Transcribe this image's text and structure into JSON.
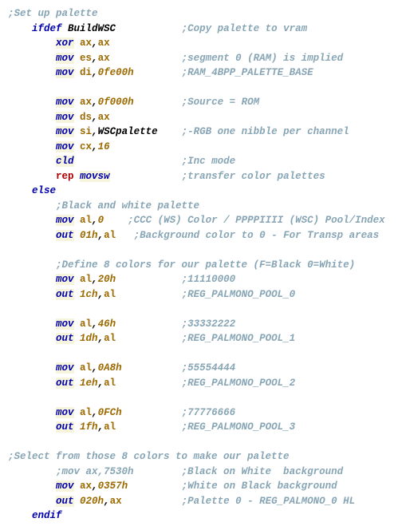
{
  "lines": [
    [
      [
        "comment",
        ";Set up palette"
      ]
    ],
    [
      [
        "plain",
        "    "
      ],
      [
        "pp",
        "ifdef"
      ],
      [
        "plain",
        " "
      ],
      [
        "ident",
        "BuildWSC"
      ],
      [
        "plain",
        "           "
      ],
      [
        "comment",
        ";Copy palette to vram"
      ]
    ],
    [
      [
        "plain",
        "        "
      ],
      [
        "inst-bg",
        "xor"
      ],
      [
        "plain",
        " "
      ],
      [
        "reg",
        "ax"
      ],
      [
        "sym",
        ","
      ],
      [
        "reg",
        "ax"
      ]
    ],
    [
      [
        "plain",
        "        "
      ],
      [
        "inst-bg",
        "mov"
      ],
      [
        "plain",
        " "
      ],
      [
        "reg",
        "es"
      ],
      [
        "sym",
        ","
      ],
      [
        "reg",
        "ax"
      ],
      [
        "plain",
        "            "
      ],
      [
        "comment",
        ";segment 0 (RAM) is implied"
      ]
    ],
    [
      [
        "plain",
        "        "
      ],
      [
        "inst-bg",
        "mov"
      ],
      [
        "plain",
        " "
      ],
      [
        "reg",
        "di"
      ],
      [
        "sym",
        ","
      ],
      [
        "num",
        "0fe00h"
      ],
      [
        "plain",
        "        "
      ],
      [
        "comment",
        ";RAM_4BPP_PALETTE_BASE"
      ]
    ],
    [
      [
        "plain",
        " "
      ]
    ],
    [
      [
        "plain",
        "        "
      ],
      [
        "inst-bg",
        "mov"
      ],
      [
        "plain",
        " "
      ],
      [
        "reg",
        "ax"
      ],
      [
        "sym",
        ","
      ],
      [
        "num",
        "0f000h"
      ],
      [
        "plain",
        "        "
      ],
      [
        "comment",
        ";Source = ROM"
      ]
    ],
    [
      [
        "plain",
        "        "
      ],
      [
        "inst-bg",
        "mov"
      ],
      [
        "plain",
        " "
      ],
      [
        "reg",
        "ds"
      ],
      [
        "sym",
        ","
      ],
      [
        "reg",
        "ax"
      ]
    ],
    [
      [
        "plain",
        "        "
      ],
      [
        "inst-bg",
        "mov"
      ],
      [
        "plain",
        " "
      ],
      [
        "reg",
        "si"
      ],
      [
        "sym",
        ","
      ],
      [
        "ident",
        "WSCpalette"
      ],
      [
        "plain",
        "    "
      ],
      [
        "comment",
        ";-RGB one nibble per channel"
      ]
    ],
    [
      [
        "plain",
        "        "
      ],
      [
        "inst-bg",
        "mov"
      ],
      [
        "plain",
        " "
      ],
      [
        "reg",
        "cx"
      ],
      [
        "sym",
        ","
      ],
      [
        "num",
        "16"
      ]
    ],
    [
      [
        "plain",
        "        "
      ],
      [
        "inst-bg",
        "cld"
      ],
      [
        "plain",
        "                  "
      ],
      [
        "comment",
        ";Inc mode"
      ]
    ],
    [
      [
        "plain",
        "        "
      ],
      [
        "rep",
        "rep"
      ],
      [
        "plain",
        " "
      ],
      [
        "inst-bg",
        "movsw"
      ],
      [
        "plain",
        "            "
      ],
      [
        "comment",
        ";transfer color palettes"
      ]
    ],
    [
      [
        "plain",
        "    "
      ],
      [
        "pp",
        "else"
      ]
    ],
    [
      [
        "plain",
        "        "
      ],
      [
        "comment",
        ";Black and white palette"
      ]
    ],
    [
      [
        "plain",
        "        "
      ],
      [
        "inst-bg",
        "mov"
      ],
      [
        "plain",
        " "
      ],
      [
        "reg",
        "al"
      ],
      [
        "sym",
        ","
      ],
      [
        "num",
        "0"
      ],
      [
        "plain",
        "    "
      ],
      [
        "comment",
        ";CCC (WS) Color / PPPPIIII (WSC) Pool/Index"
      ]
    ],
    [
      [
        "plain",
        "        "
      ],
      [
        "inst-bg",
        "out"
      ],
      [
        "plain",
        " "
      ],
      [
        "num",
        "01h"
      ],
      [
        "sym",
        ","
      ],
      [
        "reg",
        "al"
      ],
      [
        "plain",
        "   "
      ],
      [
        "comment",
        ";Background color to 0 - For Transp areas"
      ]
    ],
    [
      [
        "plain",
        " "
      ]
    ],
    [
      [
        "plain",
        "        "
      ],
      [
        "comment",
        ";Define 8 colors for our palette (F=Black 0=White)"
      ]
    ],
    [
      [
        "plain",
        "        "
      ],
      [
        "inst-bg",
        "mov"
      ],
      [
        "plain",
        " "
      ],
      [
        "reg",
        "al"
      ],
      [
        "sym",
        ","
      ],
      [
        "num",
        "20h"
      ],
      [
        "plain",
        "           "
      ],
      [
        "comment",
        ";11110000"
      ]
    ],
    [
      [
        "plain",
        "        "
      ],
      [
        "inst-bg",
        "out"
      ],
      [
        "plain",
        " "
      ],
      [
        "num",
        "1ch"
      ],
      [
        "sym",
        ","
      ],
      [
        "reg",
        "al"
      ],
      [
        "plain",
        "           "
      ],
      [
        "comment",
        ";REG_PALMONO_POOL_0"
      ]
    ],
    [
      [
        "plain",
        " "
      ]
    ],
    [
      [
        "plain",
        "        "
      ],
      [
        "inst-bg",
        "mov"
      ],
      [
        "plain",
        " "
      ],
      [
        "reg",
        "al"
      ],
      [
        "sym",
        ","
      ],
      [
        "num",
        "46h"
      ],
      [
        "plain",
        "           "
      ],
      [
        "comment",
        ";33332222"
      ]
    ],
    [
      [
        "plain",
        "        "
      ],
      [
        "inst-bg",
        "out"
      ],
      [
        "plain",
        " "
      ],
      [
        "num",
        "1dh"
      ],
      [
        "sym",
        ","
      ],
      [
        "reg",
        "al"
      ],
      [
        "plain",
        "           "
      ],
      [
        "comment",
        ";REG_PALMONO_POOL_1"
      ]
    ],
    [
      [
        "plain",
        " "
      ]
    ],
    [
      [
        "plain",
        "        "
      ],
      [
        "inst-bg",
        "mov"
      ],
      [
        "plain",
        " "
      ],
      [
        "reg",
        "al"
      ],
      [
        "sym",
        ","
      ],
      [
        "num",
        "0A8h"
      ],
      [
        "plain",
        "          "
      ],
      [
        "comment",
        ";55554444"
      ]
    ],
    [
      [
        "plain",
        "        "
      ],
      [
        "inst-bg",
        "out"
      ],
      [
        "plain",
        " "
      ],
      [
        "num",
        "1eh"
      ],
      [
        "sym",
        ","
      ],
      [
        "reg",
        "al"
      ],
      [
        "plain",
        "           "
      ],
      [
        "comment",
        ";REG_PALMONO_POOL_2"
      ]
    ],
    [
      [
        "plain",
        " "
      ]
    ],
    [
      [
        "plain",
        "        "
      ],
      [
        "inst-bg",
        "mov"
      ],
      [
        "plain",
        " "
      ],
      [
        "reg",
        "al"
      ],
      [
        "sym",
        ","
      ],
      [
        "num",
        "0FCh"
      ],
      [
        "plain",
        "          "
      ],
      [
        "comment",
        ";77776666"
      ]
    ],
    [
      [
        "plain",
        "        "
      ],
      [
        "inst-bg",
        "out"
      ],
      [
        "plain",
        " "
      ],
      [
        "num",
        "1fh"
      ],
      [
        "sym",
        ","
      ],
      [
        "reg",
        "al"
      ],
      [
        "plain",
        "           "
      ],
      [
        "comment",
        ";REG_PALMONO_POOL_3"
      ]
    ],
    [
      [
        "plain",
        " "
      ]
    ],
    [
      [
        "comment",
        ";Select from those 8 colors to make our palette"
      ]
    ],
    [
      [
        "plain",
        "        "
      ],
      [
        "comment",
        ";mov ax,7530h        ;Black on White  background"
      ]
    ],
    [
      [
        "plain",
        "        "
      ],
      [
        "inst-bg",
        "mov"
      ],
      [
        "plain",
        " "
      ],
      [
        "reg",
        "ax"
      ],
      [
        "sym",
        ","
      ],
      [
        "num",
        "0357h"
      ],
      [
        "plain",
        "         "
      ],
      [
        "comment",
        ";White on Black background"
      ]
    ],
    [
      [
        "plain",
        "        "
      ],
      [
        "inst-bg",
        "out"
      ],
      [
        "plain",
        " "
      ],
      [
        "num",
        "020h"
      ],
      [
        "sym",
        ","
      ],
      [
        "reg",
        "ax"
      ],
      [
        "plain",
        "          "
      ],
      [
        "comment",
        ";Palette 0 - REG_PALMONO_0 HL"
      ]
    ],
    [
      [
        "plain",
        "    "
      ],
      [
        "pp",
        "endif"
      ]
    ]
  ]
}
